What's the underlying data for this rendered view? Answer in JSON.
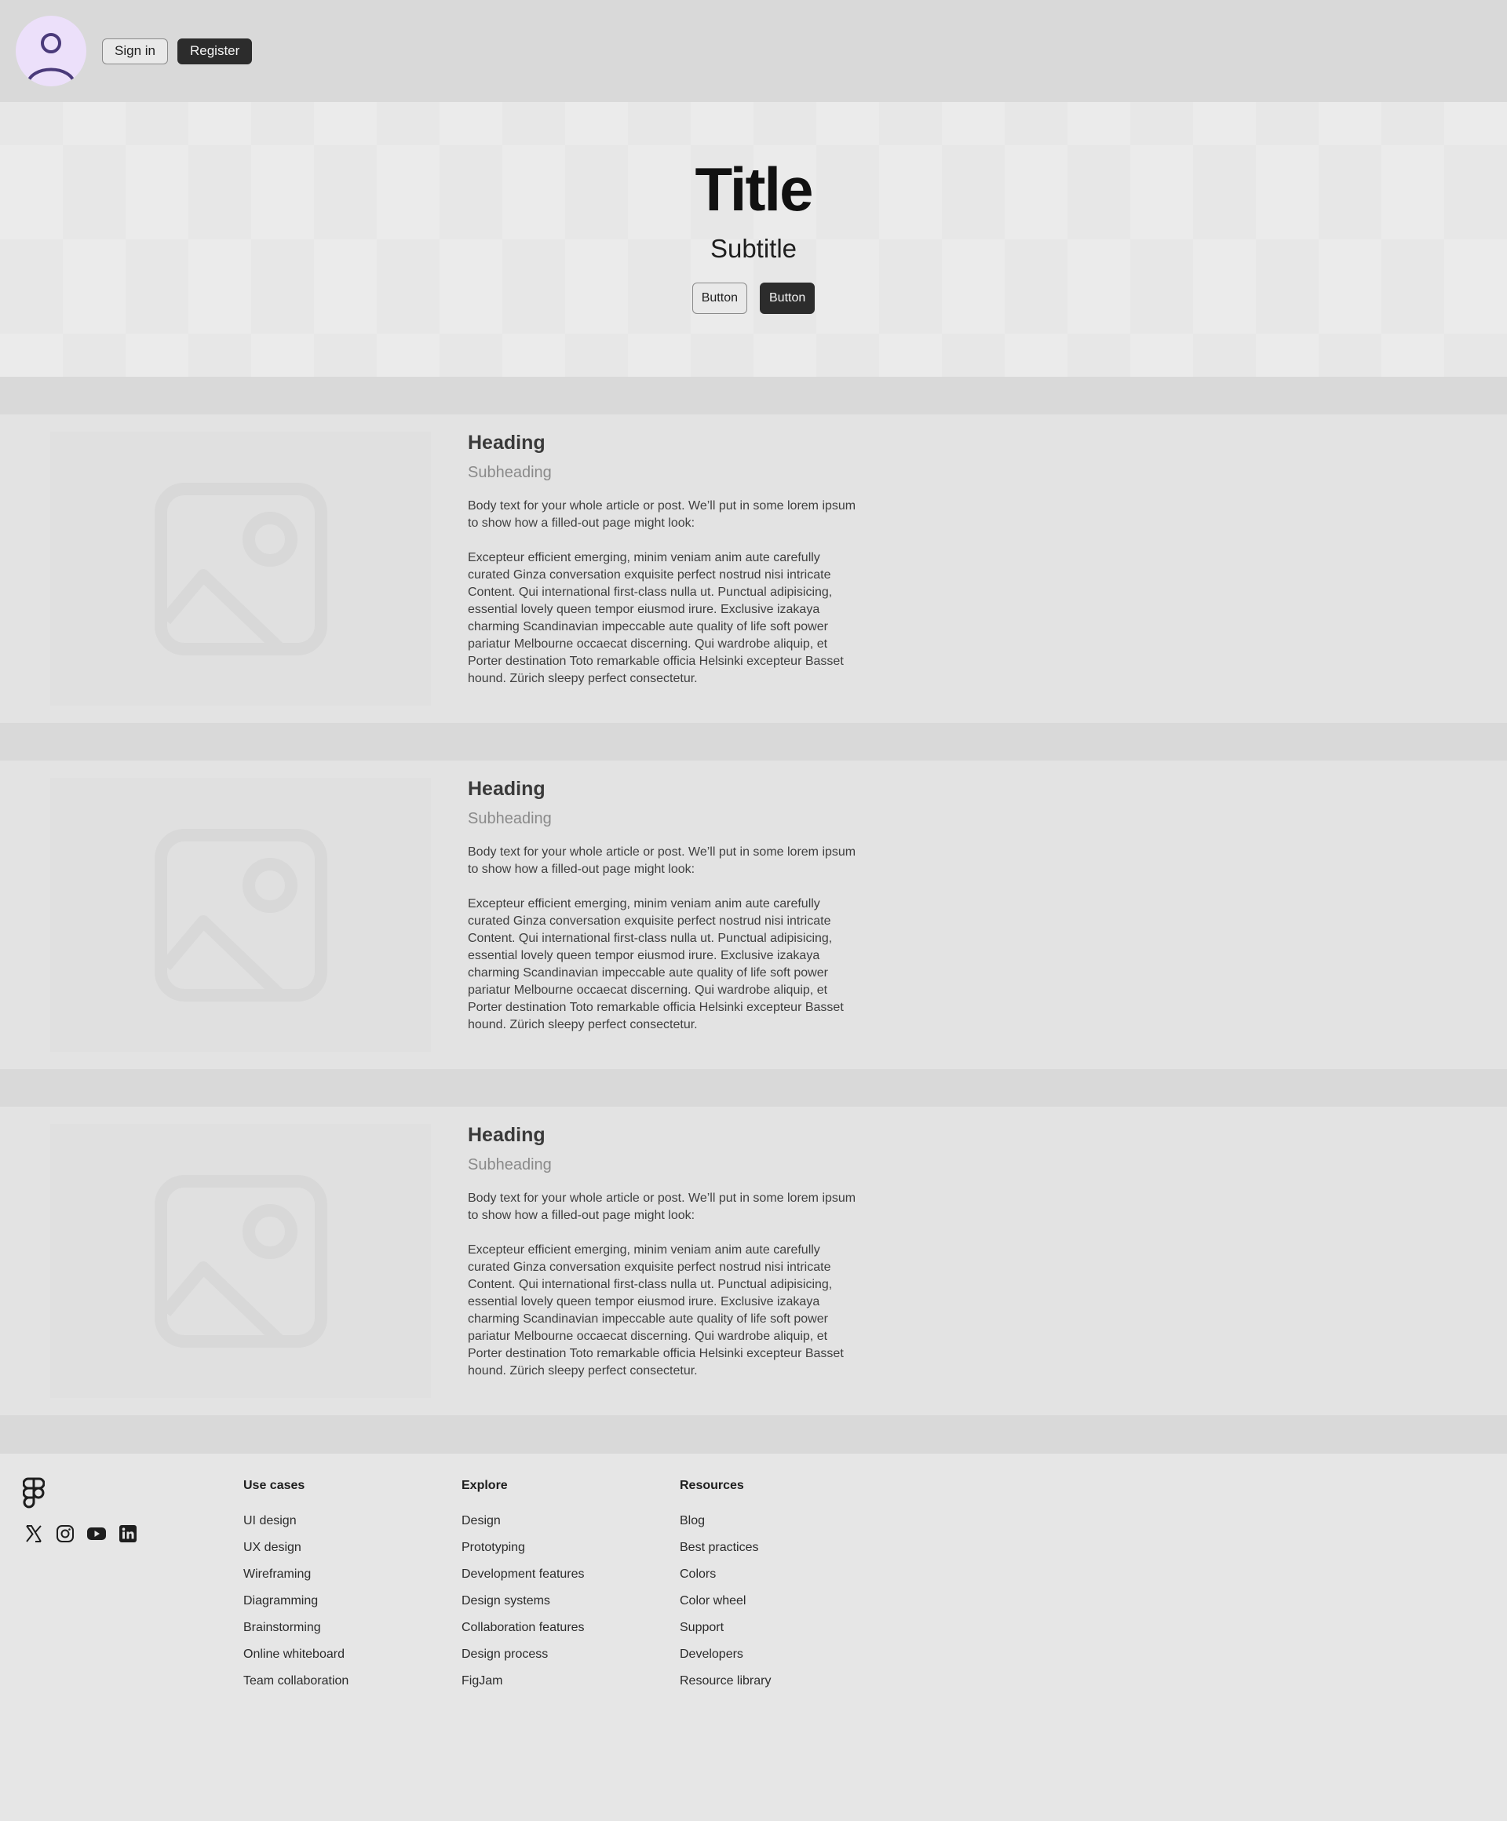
{
  "header": {
    "signin_label": "Sign in",
    "register_label": "Register",
    "avatar_icon": "user-icon"
  },
  "hero": {
    "title": "Title",
    "subtitle": "Subtitle",
    "button1_label": "Button",
    "button2_label": "Button"
  },
  "articles": [
    {
      "heading": "Heading",
      "subheading": "Subheading",
      "body1": "Body text for your whole article or post. We’ll put in some lorem ipsum to show how a filled-out page might look:",
      "body2": "Excepteur efficient emerging, minim veniam anim aute carefully curated Ginza conversation exquisite perfect nostrud nisi intricate Content. Qui  international first-class nulla ut. Punctual adipisicing, essential lovely queen tempor eiusmod irure. Exclusive izakaya charming Scandinavian impeccable aute quality of life soft power pariatur Melbourne occaecat discerning. Qui wardrobe aliquip, et Porter destination Toto remarkable officia Helsinki excepteur Basset hound. Zürich sleepy perfect consectetur.",
      "image_icon": "image-placeholder-icon"
    },
    {
      "heading": "Heading",
      "subheading": "Subheading",
      "body1": "Body text for your whole article or post. We’ll put in some lorem ipsum to show how a filled-out page might look:",
      "body2": "Excepteur efficient emerging, minim veniam anim aute carefully curated Ginza conversation exquisite perfect nostrud nisi intricate Content. Qui  international first-class nulla ut. Punctual adipisicing, essential lovely queen tempor eiusmod irure. Exclusive izakaya charming Scandinavian impeccable aute quality of life soft power pariatur Melbourne occaecat discerning. Qui wardrobe aliquip, et Porter destination Toto remarkable officia Helsinki excepteur Basset hound. Zürich sleepy perfect consectetur.",
      "image_icon": "image-placeholder-icon"
    },
    {
      "heading": "Heading",
      "subheading": "Subheading",
      "body1": "Body text for your whole article or post. We’ll put in some lorem ipsum to show how a filled-out page might look:",
      "body2": "Excepteur efficient emerging, minim veniam anim aute carefully curated Ginza conversation exquisite perfect nostrud nisi intricate Content. Qui  international first-class nulla ut. Punctual adipisicing, essential lovely queen tempor eiusmod irure. Exclusive izakaya charming Scandinavian impeccable aute quality of life soft power pariatur Melbourne occaecat discerning. Qui wardrobe aliquip, et Porter destination Toto remarkable officia Helsinki excepteur Basset hound. Zürich sleepy perfect consectetur.",
      "image_icon": "image-placeholder-icon"
    }
  ],
  "footer": {
    "logo_icon": "figma-logo-icon",
    "social_icons": [
      "x-icon",
      "instagram-icon",
      "youtube-icon",
      "linkedin-icon"
    ],
    "columns": [
      {
        "title": "Use cases",
        "items": [
          "UI design",
          "UX design",
          "Wireframing",
          "Diagramming",
          "Brainstorming",
          "Online whiteboard",
          "Team collaboration"
        ]
      },
      {
        "title": "Explore",
        "items": [
          "Design",
          "Prototyping",
          "Development features",
          "Design systems",
          "Collaboration features",
          "Design process",
          "FigJam"
        ]
      },
      {
        "title": "Resources",
        "items": [
          "Blog",
          "Best practices",
          "Colors",
          "Color wheel",
          "Support",
          "Developers",
          "Resource library"
        ]
      }
    ]
  },
  "colors": {
    "page_background": "#d9d9d9",
    "avatar_background": "#ece0fa",
    "avatar_icon": "#4a3a7a",
    "dark_button": "#2c2c2c"
  }
}
